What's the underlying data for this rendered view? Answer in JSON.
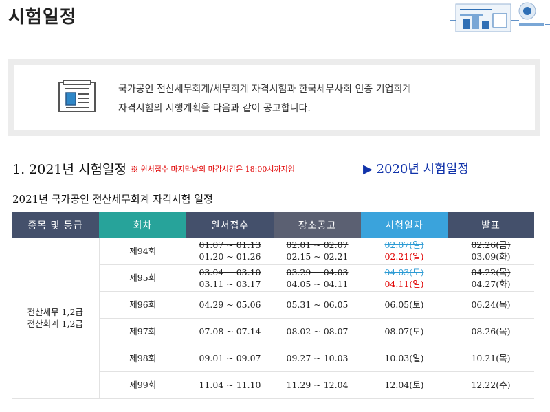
{
  "page": {
    "title": "시험일정"
  },
  "notice": {
    "line1": "국가공인 전산세무회계/세무회계 자격시험과 한국세무사회 인증 기업회계",
    "line2": "자격시험의 시행계획을 다음과 같이 공고합니다."
  },
  "section": {
    "title": "1. 2021년 시험일정",
    "note": "※ 원서접수 마지막날의 마감시간은 18:00시까지임",
    "prev_link": "▶ 2020년 시험일정"
  },
  "table": {
    "title": "2021년 국가공인 전산세무회계 자격시험 일정",
    "headers": [
      "종목 및 등급",
      "회차",
      "원서접수",
      "장소공고",
      "시험일자",
      "발표"
    ],
    "grade_line1": "전산세무 1,2급",
    "grade_line2": "전산회계 1,2급",
    "rows": [
      {
        "round": "제94회",
        "apply_old": "01.07 ~ 01.13",
        "apply": "01.20 ~ 01.26",
        "venue_old": "02.01 ~ 02.07",
        "venue": "02.15 ~ 02.21",
        "exam_old": "02.07(일)",
        "exam": "02.21(일)",
        "result_old": "02.26(금)",
        "result": "03.09(화)"
      },
      {
        "round": "제95회",
        "apply_old": "03.04 ~ 03.10",
        "apply": "03.11 ~ 03.17",
        "venue_old": "03.29 ~ 04.03",
        "venue": "04.05 ~ 04.11",
        "exam_old": "04.03(토)",
        "exam": "04.11(일)",
        "result_old": "04.22(목)",
        "result": "04.27(화)"
      },
      {
        "round": "제96회",
        "apply": "04.29 ~ 05.06",
        "venue": "05.31 ~ 06.05",
        "exam": "06.05(토)",
        "result": "06.24(목)"
      },
      {
        "round": "제97회",
        "apply": "07.08 ~ 07.14",
        "venue": "08.02 ~ 08.07",
        "exam": "08.07(토)",
        "result": "08.26(목)"
      },
      {
        "round": "제98회",
        "apply": "09.01 ~ 09.07",
        "venue": "09.27 ~ 10.03",
        "exam": "10.03(일)",
        "result": "10.21(목)"
      },
      {
        "round": "제99회",
        "apply": "11.04 ~ 11.10",
        "venue": "11.29 ~ 12.04",
        "exam": "12.04(토)",
        "result": "12.22(수)"
      }
    ]
  },
  "colors": {
    "header_dark": "#44506b",
    "header_teal": "#27a39a",
    "header_gray": "#5b6072",
    "header_sky": "#3aa3dc",
    "saturday_blue": "#2b9ad3",
    "sunday_red": "#e00000"
  }
}
